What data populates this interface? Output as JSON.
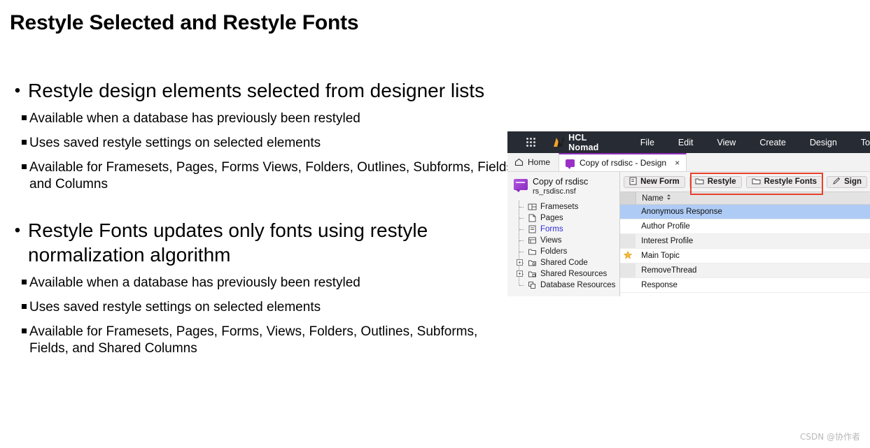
{
  "slide": {
    "title": "Restyle Selected and Restyle Fonts",
    "bullet_char": "•",
    "groups": [
      {
        "heading": "Restyle design elements selected from designer lists",
        "subs": [
          "Available when a database has previously been restyled",
          "Uses saved restyle settings on selected elements",
          "Available for Framesets, Pages, Forms Views, Folders, Outlines, Subforms, Fields and Columns"
        ]
      },
      {
        "heading": "Restyle Fonts updates only fonts using restyle normalization algorithm",
        "subs": [
          "Available when a database has previously been restyled",
          "Uses saved restyle settings on selected elements",
          "Available for Framesets, Pages, Forms, Views, Folders, Outlines, Subforms, Fields, and Shared Columns"
        ]
      }
    ]
  },
  "app": {
    "header": {
      "waffle_icon": "apps-grid-icon",
      "logo_icon": "hcl-logo-icon",
      "brand": "HCL Nomad",
      "menu": [
        "File",
        "Edit",
        "View",
        "Create",
        "Design",
        "To"
      ]
    },
    "tabs": {
      "home_icon": "home-icon",
      "home_label": "Home",
      "doc_icon": "database-icon",
      "doc_label": "Copy of rsdisc - Design",
      "close_label": "×"
    },
    "sidebar": {
      "db_icon": "database-icon",
      "db_title": "Copy of rsdisc",
      "db_file": "rs_rsdisc.nsf",
      "tree": [
        {
          "label": "Framesets",
          "icon": "frameset-icon",
          "expandable": false,
          "selected": false
        },
        {
          "label": "Pages",
          "icon": "page-icon",
          "expandable": false,
          "selected": false
        },
        {
          "label": "Forms",
          "icon": "form-icon",
          "expandable": false,
          "selected": true
        },
        {
          "label": "Views",
          "icon": "view-icon",
          "expandable": false,
          "selected": false
        },
        {
          "label": "Folders",
          "icon": "folder-icon",
          "expandable": false,
          "selected": false
        },
        {
          "label": "Shared Code",
          "icon": "shared-code-icon",
          "expandable": true,
          "selected": false
        },
        {
          "label": "Shared Resources",
          "icon": "shared-resources-icon",
          "expandable": true,
          "selected": false
        },
        {
          "label": "Database Resources",
          "icon": "database-resources-icon",
          "expandable": false,
          "selected": false
        }
      ]
    },
    "toolbar": {
      "buttons": [
        {
          "label": "New Form",
          "icon": "new-form-icon"
        },
        {
          "label": "Restyle",
          "icon": "folder-icon"
        },
        {
          "label": "Restyle Fonts",
          "icon": "folder-icon"
        },
        {
          "label": "Sign",
          "icon": "pencil-icon"
        }
      ],
      "highlight_color": "#e8412a"
    },
    "list": {
      "column_header": "Name",
      "sort_glyph": "⌃⌄",
      "rows": [
        {
          "name": "Anonymous Response",
          "starred": false,
          "selected": true
        },
        {
          "name": "Author Profile",
          "starred": false,
          "selected": false
        },
        {
          "name": "Interest Profile",
          "starred": false,
          "selected": false
        },
        {
          "name": "Main Topic",
          "starred": true,
          "selected": false
        },
        {
          "name": "RemoveThread",
          "starred": false,
          "selected": false
        },
        {
          "name": "Response",
          "starred": false,
          "selected": false
        }
      ],
      "star_glyph": "★",
      "star_color": "#f4ba3a"
    }
  },
  "watermark": "CSDN @协作者"
}
